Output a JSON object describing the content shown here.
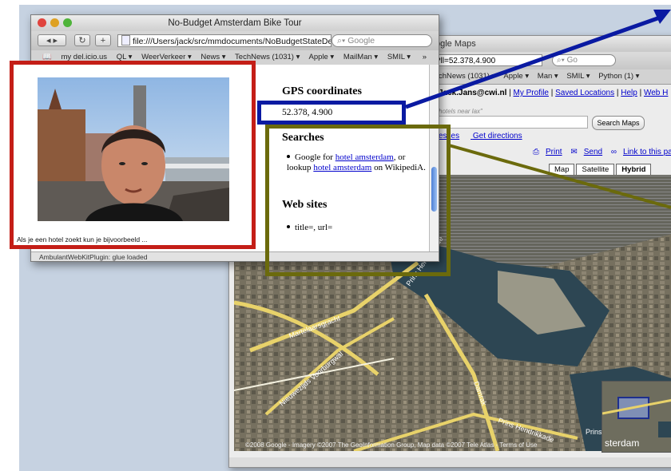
{
  "front_window": {
    "title": "No-Budget Amsterdam Bike Tour",
    "url": "file:///Users/jack/src/mmdocuments/NoBudgetStateDe",
    "search_placeholder": "Google",
    "bookmarks": [
      "my del.icio.us",
      "QL ▾",
      "WeerVerkeer ▾",
      "News ▾",
      "TechNews (1031) ▾",
      "Apple ▾",
      "MailMan ▾",
      "SMIL ▾"
    ],
    "overflow": "»",
    "status": "AmbulantWebKitPlugin: glue loaded",
    "content": {
      "gps_heading": "GPS coordinates",
      "gps_value": "52.378, 4.900",
      "searches_heading": "Searches",
      "search_item_prefix": "Google for",
      "search_item_link1": "hotel amsterdam",
      "search_item_mid": ", or lookup",
      "search_item_link2": "hotel amsterdam",
      "search_item_suffix": "on WikipediA.",
      "websites_heading": "Web sites",
      "websites_item": "title=, url="
    }
  },
  "video": {
    "caption": "Als je een hotel zoekt kun je bijvoorbeeld ..."
  },
  "maps_window": {
    "title": "ogle Maps",
    "url": "?ll=52.378,4.900",
    "search_placeholder": "Go",
    "bookmarks": [
      "chNews (1031) ▾",
      "Apple ▾",
      "Man ▾",
      "SMIL ▾",
      "Python (1) ▾"
    ],
    "user": "Jack.Jans",
    "user_rest": "@cwi.nl",
    "links": [
      "My Profile",
      "Saved Locations",
      "Help",
      "Web H"
    ],
    "hint": "hotels near lax\"",
    "search_button": "Search Maps",
    "find_links": [
      "esses",
      "Get directions"
    ],
    "share_links": [
      "Print",
      "Send",
      "Link to this page"
    ],
    "map_types": [
      "Map",
      "Satellite",
      "Hybrid"
    ],
    "map_type_selected": "Hybrid",
    "footer": "©2008 Google - Imagery ©2007 The GeoInformation Group, Map data ©2007 Tele Atlas - Terms of Use",
    "mini_label": "sterdam",
    "street_labels": [
      "Prins Hendrikkade",
      "Martelaarsgracht",
      "Nieuwezijds Voorburgwal",
      "Damrak",
      "Prins"
    ]
  }
}
